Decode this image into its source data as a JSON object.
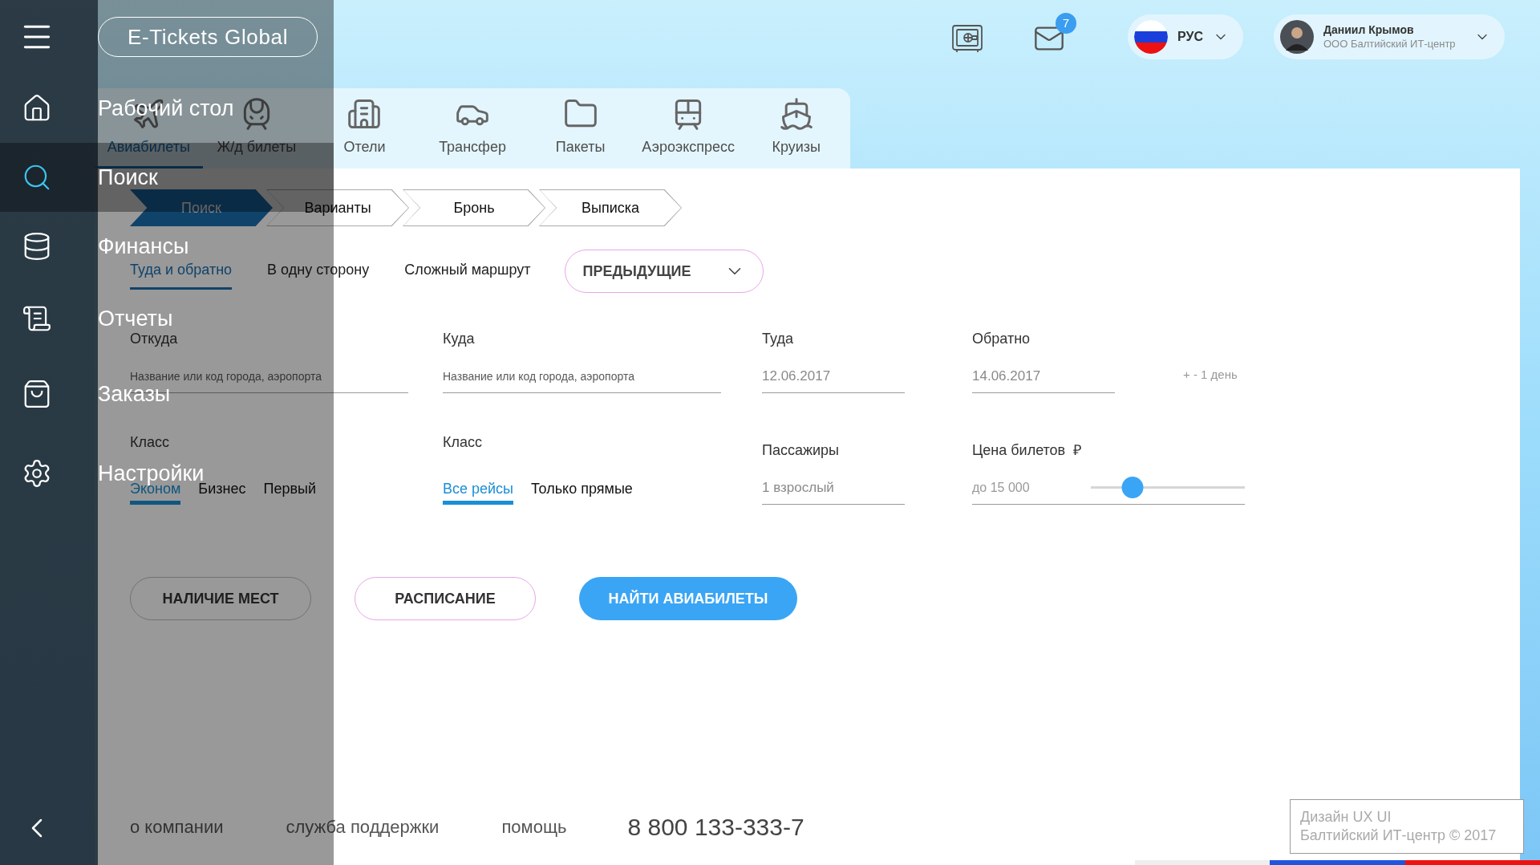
{
  "sidebar": {
    "logo": "E-Tickets Global",
    "items": [
      {
        "label": "Рабочий стол",
        "selected": false
      },
      {
        "label": "Поиск",
        "selected": true
      },
      {
        "label": "Финансы",
        "selected": false
      },
      {
        "label": "Отчеты",
        "selected": false
      },
      {
        "label": "Заказы",
        "selected": false
      },
      {
        "label": "Настройки",
        "selected": false
      }
    ]
  },
  "header": {
    "mail_count": "7",
    "language": "РУС",
    "user": {
      "name": "Даниил Крымов",
      "company": "ООО Балтийский ИТ-центр"
    }
  },
  "tabs": [
    {
      "label": "Авиабилеты",
      "selected": true
    },
    {
      "label": "Ж/д билеты",
      "selected": false
    },
    {
      "label": "Отели",
      "selected": false
    },
    {
      "label": "Трансфер",
      "selected": false
    },
    {
      "label": "Пакеты",
      "selected": false
    },
    {
      "label": "Аэроэкспресс",
      "selected": false
    },
    {
      "label": "Круизы",
      "selected": false
    }
  ],
  "steps": [
    {
      "label": "Поиск",
      "selected": true
    },
    {
      "label": "Варианты",
      "selected": false
    },
    {
      "label": "Бронь",
      "selected": false
    },
    {
      "label": "Выписка",
      "selected": false
    }
  ],
  "trip_types": [
    {
      "label": "Туда и обратно",
      "selected": true
    },
    {
      "label": "В одну сторону",
      "selected": false
    },
    {
      "label": "Сложный маршрут",
      "selected": false
    }
  ],
  "previous_button": "ПРЕДЫДУЩИЕ",
  "fields": [
    {
      "label": "Откуда",
      "placeholder": "Название или код города, аэропорта"
    },
    {
      "label": "Куда",
      "placeholder": "Название или код города, аэропорта"
    },
    {
      "label": "Туда",
      "value": "12.06.2017"
    },
    {
      "label": "Обратно",
      "value": "14.06.2017"
    }
  ],
  "date_shift": "+ - 1 день",
  "service_class": {
    "label": "Класс",
    "options": [
      {
        "label": "Эконом",
        "selected": true
      },
      {
        "label": "Бизнес",
        "selected": false
      },
      {
        "label": "Первый",
        "selected": false
      }
    ]
  },
  "flight_filter": {
    "label": "Класс",
    "options": [
      {
        "label": "Все рейсы",
        "selected": true
      },
      {
        "label": "Только прямые",
        "selected": false
      }
    ]
  },
  "passengers": {
    "label": "Пассажиры",
    "value": "1 взрослый"
  },
  "price": {
    "label": "Цена билетов",
    "currency": "₽",
    "value": "до 15 000",
    "level": 0.27
  },
  "buttons": [
    {
      "label": "НАЛИЧИЕ МЕСТ",
      "kind": "outline"
    },
    {
      "label": "РАСПИСАНИЕ",
      "kind": "accent-outline"
    },
    {
      "label": "НАЙТИ АВИАБИЛЕТЫ",
      "kind": "primary"
    }
  ],
  "footer": {
    "links": [
      "о компании",
      "служба поддержки",
      "помощь"
    ],
    "phone": "8 800 133-333-7",
    "credits": [
      "Дизайн UX UI",
      "Балтийский ИТ-центр © 2017"
    ]
  }
}
